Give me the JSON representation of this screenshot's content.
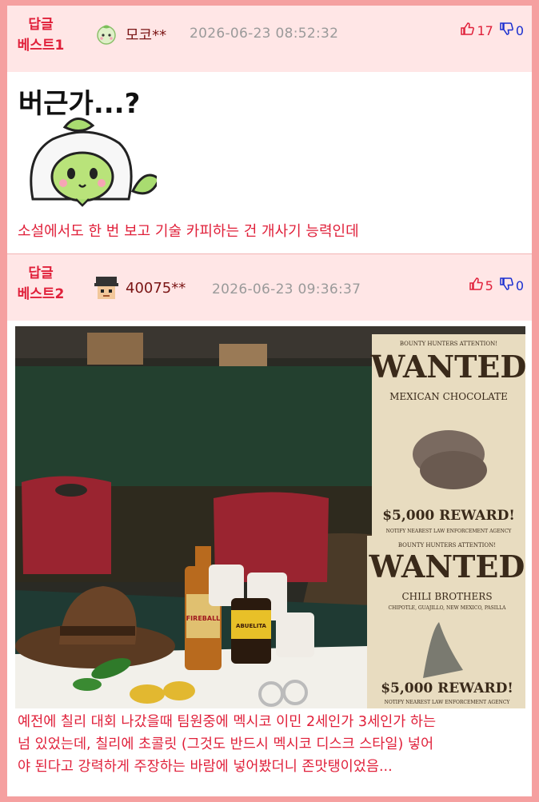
{
  "comments": [
    {
      "badge_line1": "답글",
      "badge_line2": "베스트1",
      "nickname": "모코**",
      "date": "2026-06-23 08:52:32",
      "upvotes": "17",
      "downvotes": "0",
      "sticker_text": "버근가...?",
      "text": "소설에서도 한 번 보고 기술 카피하는 건 개사기 능력인데"
    },
    {
      "badge_line1": "답글",
      "badge_line2": "베스트2",
      "nickname": "40075**",
      "date": "2026-06-23 09:36:37",
      "upvotes": "5",
      "downvotes": "0",
      "photo": {
        "poster1_header": "BOUNTY HUNTERS ATTENTION!",
        "poster1_title": "WANTED",
        "poster1_subject": "MEXICAN CHOCOLATE",
        "poster1_reward": "$5,000 REWARD!",
        "poster1_footer": "NOTIFY NEAREST LAW ENFORCEMENT AGENCY",
        "poster2_header": "BOUNTY HUNTERS ATTENTION!",
        "poster2_title": "WANTED",
        "poster2_subject": "CHILI BROTHERS",
        "poster2_sub": "CHIPOTLE, GUAJILLO, NEW MEXICO, PASILLA",
        "poster2_reward": "$5,000 REWARD!",
        "poster2_footer": "NOTIFY NEAREST LAW ENFORCEMENT AGENCY",
        "bottle_label": "FIREBALL",
        "jar_label": "ABUELITA",
        "colors": {
          "poster": "#e8dcc0",
          "table": "#1f3a33",
          "chair": "#9a2430"
        }
      },
      "text_lines": [
        "예전에 칠리 대회 나갔을때 팀원중에 멕시코 이민 2세인가 3세인가 하는",
        "넘 있었는데, 칠리에 초콜릿 (그것도 반드시 멕시코 디스크 스타일) 넣어",
        "야 된다고 강력하게 주장하는 바람에 넣어봤더니 존맛탱이었음..."
      ]
    }
  ],
  "colors": {
    "accent": "#e0203a",
    "down": "#1a2fd0",
    "header_bg": "#ffe6e6",
    "border": "#f5a0a0"
  }
}
